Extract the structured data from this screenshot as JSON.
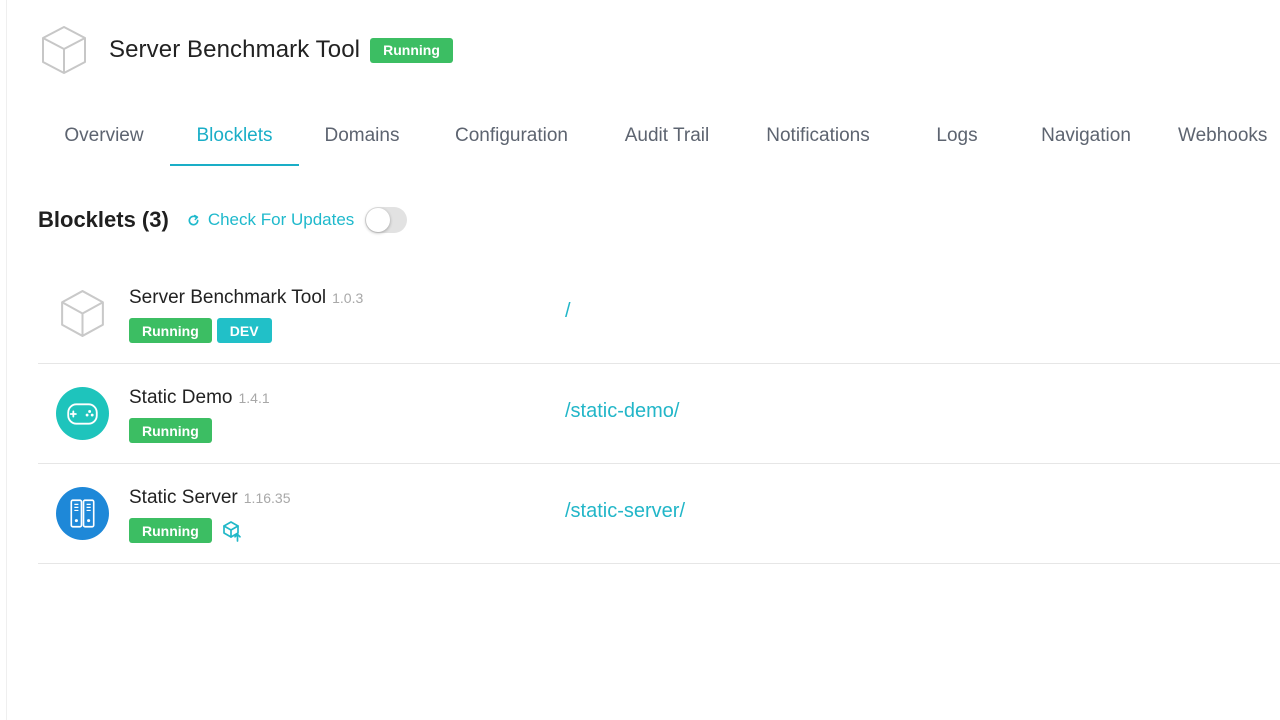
{
  "app": {
    "title": "Server Benchmark Tool",
    "status": "Running"
  },
  "tabs": [
    {
      "label": "Overview",
      "active": false
    },
    {
      "label": "Blocklets",
      "active": true
    },
    {
      "label": "Domains",
      "active": false
    },
    {
      "label": "Configuration",
      "active": false
    },
    {
      "label": "Audit Trail",
      "active": false
    },
    {
      "label": "Notifications",
      "active": false
    },
    {
      "label": "Logs",
      "active": false
    },
    {
      "label": "Navigation",
      "active": false
    },
    {
      "label": "Webhooks",
      "active": false
    }
  ],
  "section": {
    "title": "Blocklets (3)",
    "check_updates_label": "Check For Updates",
    "auto_check_enabled": false
  },
  "blocklets": [
    {
      "name": "Server Benchmark Tool",
      "version": "1.0.3",
      "status": "Running",
      "extra_badge": "DEV",
      "icon": "box-outline-icon",
      "path": "/"
    },
    {
      "name": "Static Demo",
      "version": "1.4.1",
      "status": "Running",
      "icon": "gamepad-icon",
      "path": "/static-demo/"
    },
    {
      "name": "Static Server",
      "version": "1.16.35",
      "status": "Running",
      "icon": "server-rack-icon",
      "upgrade_icon": "package-upgrade-icon",
      "path": "/static-server/"
    }
  ],
  "colors": {
    "accent": "#1aaec7",
    "running": "#3cbe63",
    "dev": "#21c0c8",
    "gamepad_bg": "#1ec4bc",
    "server_bg": "#1e88d8"
  }
}
